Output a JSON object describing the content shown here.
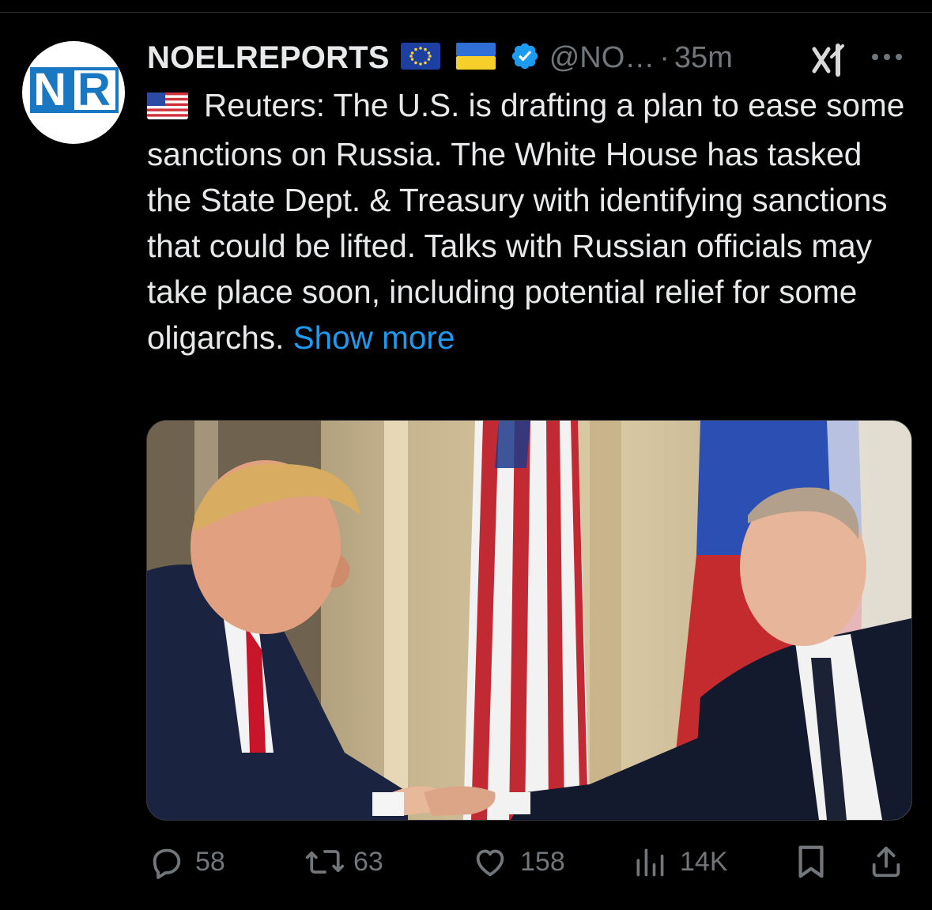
{
  "tweet": {
    "display_name": "NOELREPORTS",
    "handle": "@NO…",
    "separator": "·",
    "time": "35m",
    "text_main": "Reuters: The U.S. is drafting a plan to ease some sanctions on Russia. The White House has tasked the State Dept. & Treasury with identifying sanctions that could be lifted. Talks with Russian officials may take place soon, including potential relief for some oligarchs.",
    "show_more": "Show more",
    "avatar": {
      "letter_1": "N",
      "letter_2": "R"
    }
  },
  "actions": {
    "replies": "58",
    "reposts": "63",
    "likes": "158",
    "views": "14K"
  },
  "icons": {
    "reply": "reply-icon",
    "repost": "repost-icon",
    "like": "heart-icon",
    "views": "views-icon",
    "bookmark": "bookmark-icon",
    "share": "share-icon",
    "grok": "grok-icon",
    "more": "more-icon",
    "verified": "verified-badge-icon"
  },
  "colors": {
    "background": "#000000",
    "text": "#e7e9ea",
    "secondary": "#71767b",
    "accent": "#1d9bf0",
    "brand_blue": "#1a78c2"
  }
}
